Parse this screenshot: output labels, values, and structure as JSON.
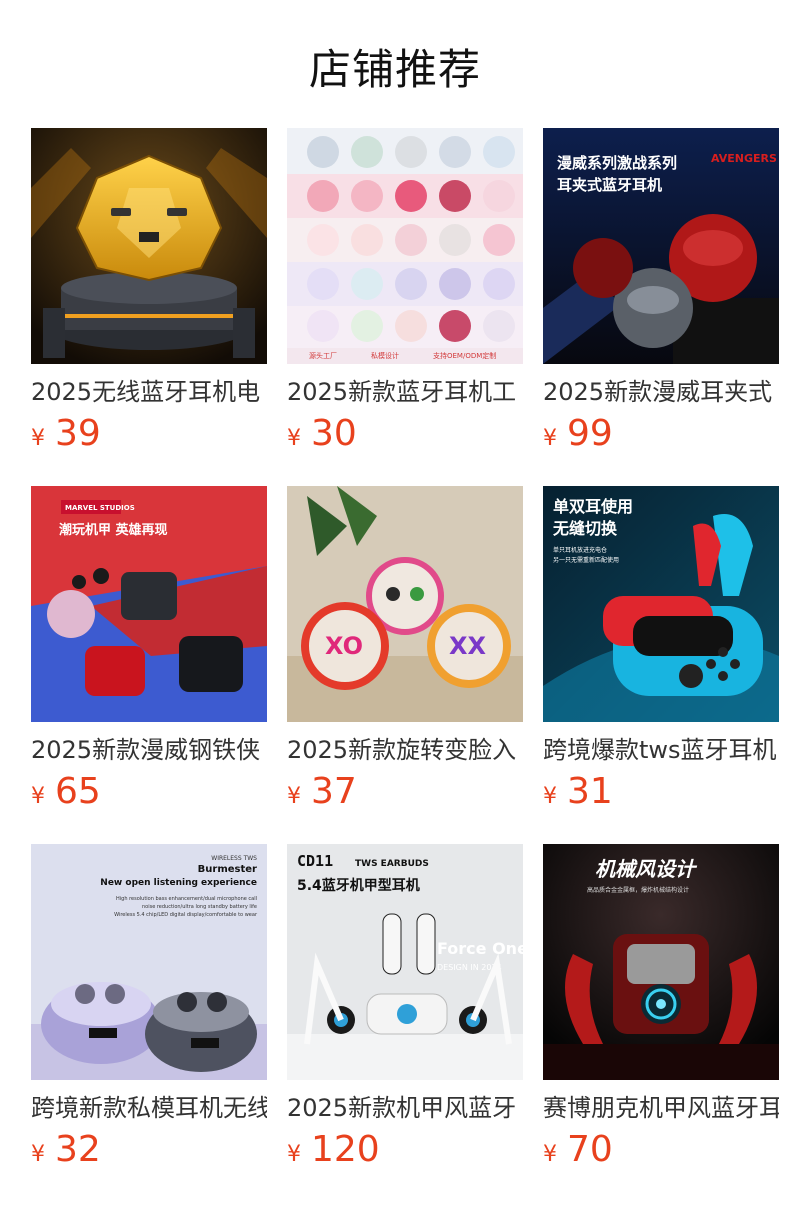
{
  "page": {
    "title": "店铺推荐"
  },
  "products": [
    {
      "name": "2025无线蓝牙耳机电",
      "currency": "¥",
      "price": "39",
      "image_text": []
    },
    {
      "name": "2025新款蓝牙耳机工",
      "currency": "¥",
      "price": "30",
      "image_text": [
        "源头工厂",
        "私模设计",
        "支持OEM/ODM定制"
      ]
    },
    {
      "name": "2025新款漫威耳夹式",
      "currency": "¥",
      "price": "99",
      "image_text": [
        "漫威系列激战系列",
        "耳夹式蓝牙耳机",
        "AVENGERS"
      ]
    },
    {
      "name": "2025新款漫威钢铁侠",
      "currency": "¥",
      "price": "65",
      "image_text": [
        "MARVEL STUDIOS",
        "潮玩机甲 英雄再现"
      ]
    },
    {
      "name": "2025新款旋转变脸入",
      "currency": "¥",
      "price": "37",
      "image_text": []
    },
    {
      "name": "跨境爆款tws蓝牙耳机",
      "currency": "¥",
      "price": "31",
      "image_text": [
        "单双耳使用",
        "无缝切换",
        "单只耳机放进充电仓",
        "另一只无需重新匹配使用"
      ]
    },
    {
      "name": "跨境新款私模耳机无线",
      "currency": "¥",
      "price": "32",
      "image_text": [
        "WIRELESS TWS",
        "Burmester",
        "New open listening experience",
        "High resolution bass enhancement/dual microphone call",
        "noise reduction/ultra long standby battery life",
        "Wireless 5.4 chip/LED digital display/comfortable to wear"
      ]
    },
    {
      "name": "2025新款机甲风蓝牙",
      "currency": "¥",
      "price": "120",
      "image_text": [
        "CD11",
        "TWS EARBUDS",
        "5.4蓝牙机甲型耳机",
        "Force One",
        "DESIGN IN 2024"
      ]
    },
    {
      "name": "赛博朋克机甲风蓝牙耳",
      "currency": "¥",
      "price": "70",
      "image_text": [
        "机械风设计",
        "高品质合金金属框，爆炸机械结构设计"
      ]
    }
  ],
  "colors": {
    "accent": "#e8411d",
    "text": "#333333"
  }
}
